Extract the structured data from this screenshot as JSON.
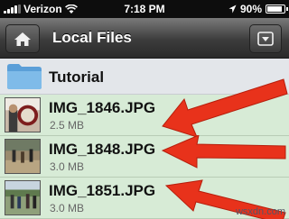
{
  "status_bar": {
    "carrier": "Verizon",
    "time": "7:18 PM",
    "battery": "90%",
    "battery_level": 0.9
  },
  "nav": {
    "title": "Local Files",
    "home_icon": "home-icon",
    "menu_icon": "dropdown-menu-icon"
  },
  "folder": {
    "name": "Tutorial",
    "icon": "folder-icon"
  },
  "files": [
    {
      "name": "IMG_1846.JPG",
      "size": "2.5 MB"
    },
    {
      "name": "IMG_1848.JPG",
      "size": "3.0 MB"
    },
    {
      "name": "IMG_1851.JPG",
      "size": "3.0 MB"
    }
  ],
  "colors": {
    "file_row_bg": "#d7ebd6",
    "folder_row_bg": "#e3e6ea",
    "arrow_red": "#e8321b"
  },
  "watermark": "wsxdn.com"
}
